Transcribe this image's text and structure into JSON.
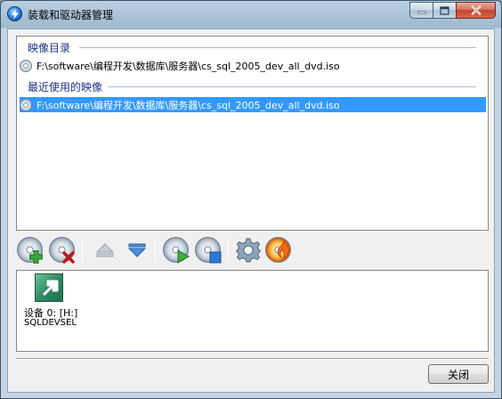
{
  "window": {
    "title": "装载和驱动器管理"
  },
  "image_list": {
    "catalog_header": "映像目录",
    "catalog_items": [
      {
        "path": "F:\\software\\编程开发\\数据库\\服务器\\cs_sql_2005_dev_all_dvd.iso"
      }
    ],
    "recent_header": "最近使用的映像",
    "recent_items": [
      {
        "path": "F:\\software\\编程开发\\数据库\\服务器\\cs_sql_2005_dev_all_dvd.iso",
        "selected": true
      }
    ]
  },
  "toolbar": {
    "icons": [
      "add-image-icon",
      "remove-image-icon",
      "eject-icon",
      "insert-icon",
      "mount-icon",
      "unmount-icon",
      "settings-icon",
      "burn-icon"
    ]
  },
  "drives": [
    {
      "label": "设备 0: [H:]",
      "volume": "SQLDEVSEL"
    }
  ],
  "footer": {
    "close_label": "关闭"
  },
  "colors": {
    "selection": "#3399ff",
    "group_header": "#1e3287"
  }
}
